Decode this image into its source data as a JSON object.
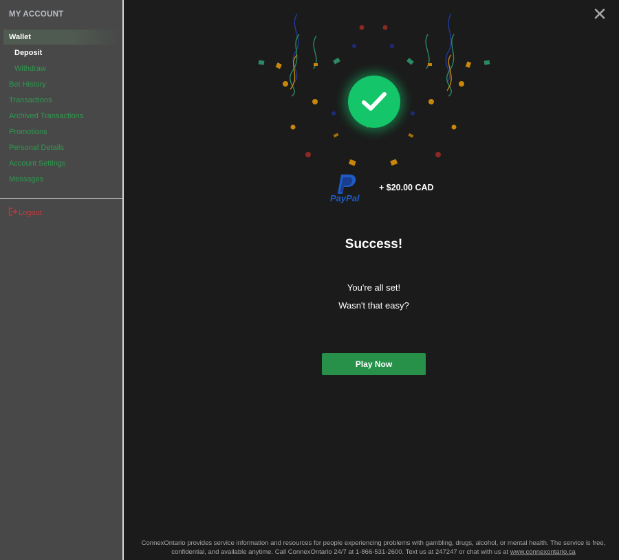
{
  "sidebar": {
    "title": "MY ACCOUNT",
    "items": [
      {
        "label": "Wallet",
        "state": "active"
      },
      {
        "label": "Deposit",
        "state": "selected-sub"
      },
      {
        "label": "Withdraw",
        "state": "sub"
      },
      {
        "label": "Bet History"
      },
      {
        "label": "Transactions"
      },
      {
        "label": "Archived Transactions"
      },
      {
        "label": "Promotions"
      },
      {
        "label": "Personal Details"
      },
      {
        "label": "Account Settings"
      },
      {
        "label": "Messages"
      }
    ],
    "logout_label": "Logout",
    "logout_icon": "logout-icon"
  },
  "header": {
    "close_icon": "close-icon"
  },
  "success": {
    "icon": "checkmark-icon",
    "payment_method": "PayPal",
    "amount": "+ $20.00 CAD",
    "title": "Success!",
    "line1": "You're all set!",
    "line2": "Wasn't that easy?",
    "button_label": "Play Now"
  },
  "footer": {
    "text": "ConnexOntario provides service information and resources for people experiencing problems with gambling, drugs, alcohol, or mental health. The service is free, confidential, and available anytime. Call ConnexOntario 24/7 at 1-866-531-2600. Text us at 247247 or chat with us at",
    "link": "www.connexontario.ca"
  },
  "colors": {
    "background": "#1b1b1b",
    "sidebar": "#484848",
    "nav_link": "#2e9a4f",
    "button": "#27914a",
    "success_circle": "#14c56a",
    "logout": "#c83a3a"
  }
}
